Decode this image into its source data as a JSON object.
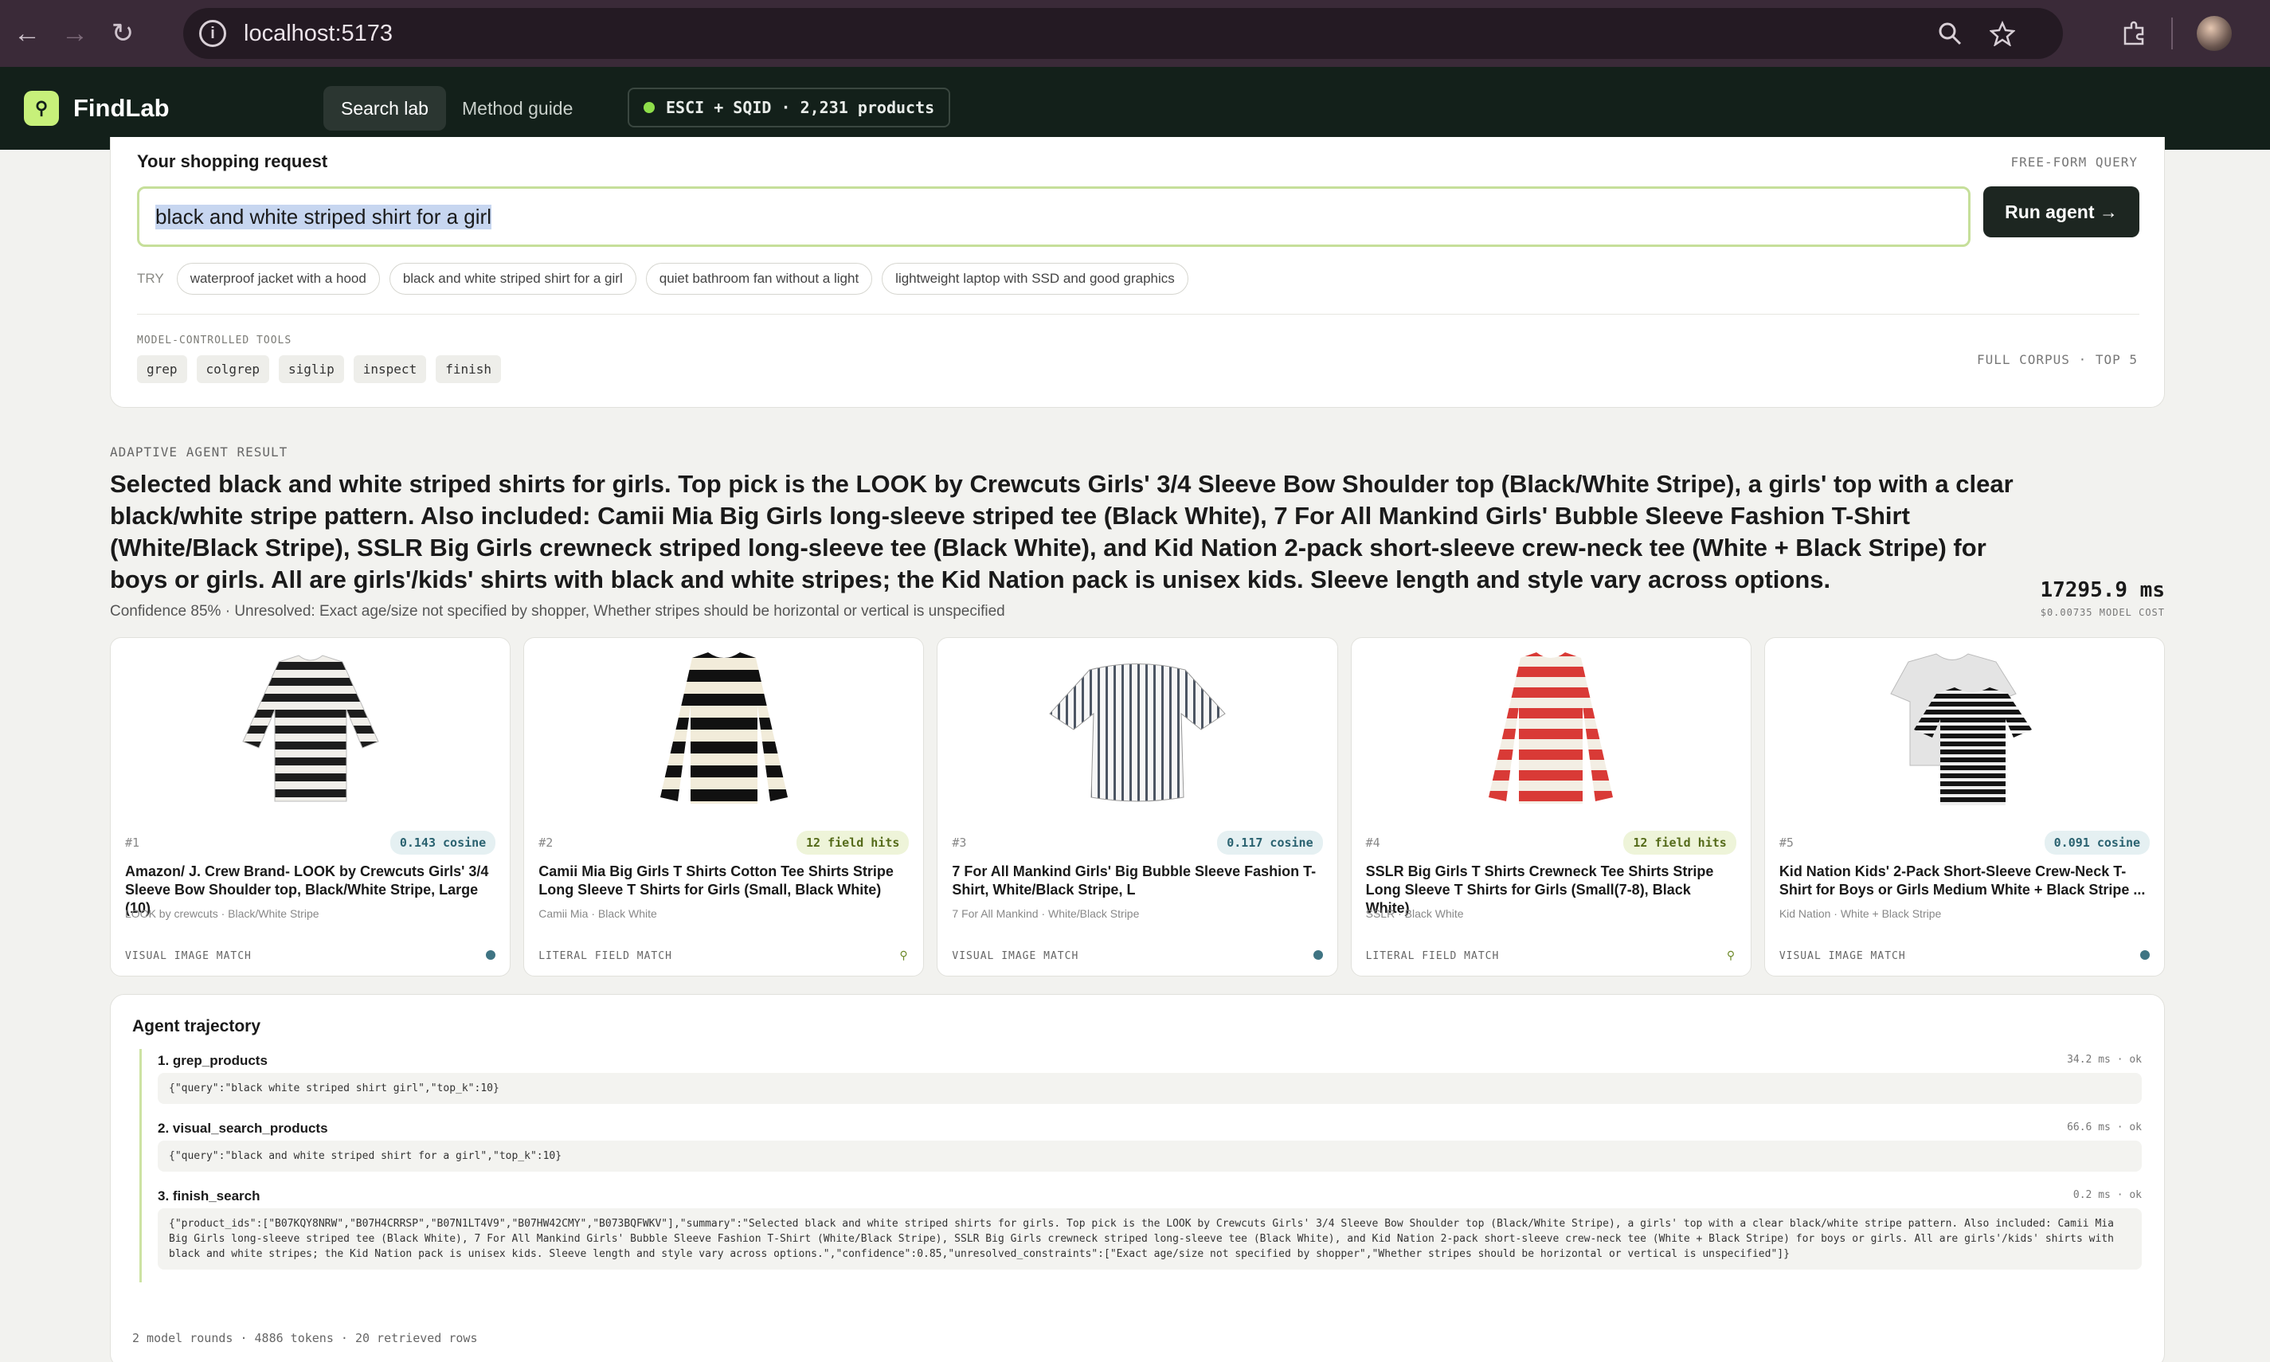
{
  "browser": {
    "url": "localhost:5173"
  },
  "app": {
    "brand": "FindLab",
    "tabs": [
      "Search lab",
      "Method guide"
    ],
    "corpus_badge": "ESCI + SQID · 2,231 products"
  },
  "request": {
    "title": "Your shopping request",
    "tag": "FREE-FORM QUERY",
    "query": "black and white striped shirt for a girl",
    "run_label": "Run agent →",
    "try_label": "TRY",
    "suggestions": [
      "waterproof jacket with a hood",
      "black and white striped shirt for a girl",
      "quiet bathroom fan without a light",
      "lightweight laptop with SSD and good graphics"
    ],
    "tools_label": "MODEL-CONTROLLED TOOLS",
    "tools": [
      "grep",
      "colgrep",
      "siglip",
      "inspect",
      "finish"
    ],
    "corpus_note": "FULL CORPUS · TOP 5"
  },
  "result": {
    "label": "ADAPTIVE AGENT RESULT",
    "summary": "Selected black and white striped shirts for girls. Top pick is the LOOK by Crewcuts Girls' 3/4 Sleeve Bow Shoulder top (Black/White Stripe), a girls' top with a clear black/white stripe pattern. Also included: Camii Mia Big Girls long-sleeve striped tee (Black White), 7 For All Mankind Girls' Bubble Sleeve Fashion T-Shirt (White/Black Stripe), SSLR Big Girls crewneck striped long-sleeve tee (Black White), and Kid Nation 2-pack short-sleeve crew-neck tee (White + Black Stripe) for boys or girls. All are girls'/kids' shirts with black and white stripes; the Kid Nation pack is unisex kids. Sleeve length and style vary across options.",
    "confidence": "Confidence 85% · Unresolved: Exact age/size not specified by shopper, Whether stripes should be horizontal or vertical is unspecified",
    "timing": "17295.9 ms",
    "cost": "$0.00735 MODEL COST"
  },
  "products": [
    {
      "rank": "#1",
      "badge": "0.143 cosine",
      "badge_type": "cos",
      "title": "Amazon/ J. Crew Brand- LOOK by Crewcuts Girls' 3/4 Sleeve Bow Shoulder top, Black/White Stripe, Large (10)",
      "meta": "LOOK by crewcuts · Black/White Stripe",
      "match": "VISUAL IMAGE MATCH",
      "icon": "visual-match-icon"
    },
    {
      "rank": "#2",
      "badge": "12 field hits",
      "badge_type": "hit",
      "title": "Camii Mia Big Girls T Shirts Cotton Tee Shirts Stripe Long Sleeve T Shirts for Girls (Small, Black White)",
      "meta": "Camii Mia · Black White",
      "match": "LITERAL FIELD MATCH",
      "icon": "literal-match-icon"
    },
    {
      "rank": "#3",
      "badge": "0.117 cosine",
      "badge_type": "cos",
      "title": "7 For All Mankind Girls' Big Bubble Sleeve Fashion T-Shirt, White/Black Stripe, L",
      "meta": "7 For All Mankind · White/Black Stripe",
      "match": "VISUAL IMAGE MATCH",
      "icon": "visual-match-icon"
    },
    {
      "rank": "#4",
      "badge": "12 field hits",
      "badge_type": "hit",
      "title": "SSLR Big Girls T Shirts Crewneck Tee Shirts Stripe Long Sleeve T Shirts for Girls (Small(7-8), Black White)",
      "meta": "SSLR · Black White",
      "match": "LITERAL FIELD MATCH",
      "icon": "literal-match-icon"
    },
    {
      "rank": "#5",
      "badge": "0.091 cosine",
      "badge_type": "cos",
      "title": "Kid Nation Kids' 2-Pack Short-Sleeve Crew-Neck T-Shirt for Boys or Girls Medium White + Black Stripe ...",
      "meta": "Kid Nation · White + Black Stripe",
      "match": "VISUAL IMAGE MATCH",
      "icon": "visual-match-icon"
    }
  ],
  "trajectory": {
    "title": "Agent trajectory",
    "steps": [
      {
        "name": "1. grep_products",
        "meta": "34.2 ms · ok",
        "args": "{\"query\":\"black white striped shirt girl\",\"top_k\":10}"
      },
      {
        "name": "2. visual_search_products",
        "meta": "66.6 ms · ok",
        "args": "{\"query\":\"black and white striped shirt for a girl\",\"top_k\":10}"
      },
      {
        "name": "3. finish_search",
        "meta": "0.2 ms · ok",
        "args": "{\"product_ids\":[\"B07KQY8NRW\",\"B07H4CRRSP\",\"B07N1LT4V9\",\"B07HW42CMY\",\"B073BQFWKV\"],\"summary\":\"Selected black and white striped shirts for girls. Top pick is the LOOK by Crewcuts Girls' 3/4 Sleeve Bow Shoulder top (Black/White Stripe), a girls' top with a clear black/white stripe pattern. Also included: Camii Mia Big Girls long-sleeve striped tee (Black White), 7 For All Mankind Girls' Bubble Sleeve Fashion T-Shirt (White/Black Stripe), SSLR Big Girls crewneck striped long-sleeve tee (Black White), and Kid Nation 2-pack short-sleeve crew-neck tee (White + Black Stripe) for boys or girls. All are girls'/kids' shirts with black and white stripes; the Kid Nation pack is unisex kids. Sleeve length and style vary across options.\",\"confidence\":0.85,\"unresolved_constraints\":[\"Exact age/size not specified by shopper\",\"Whether stripes should be horizontal or vertical is unspecified\"]}"
      }
    ],
    "stats": "2 model rounds · 4886 tokens · 20 retrieved rows"
  },
  "colors": {
    "appbar": "#13201a",
    "accent": "#c7f07a",
    "chrome": "#3a2a38"
  }
}
